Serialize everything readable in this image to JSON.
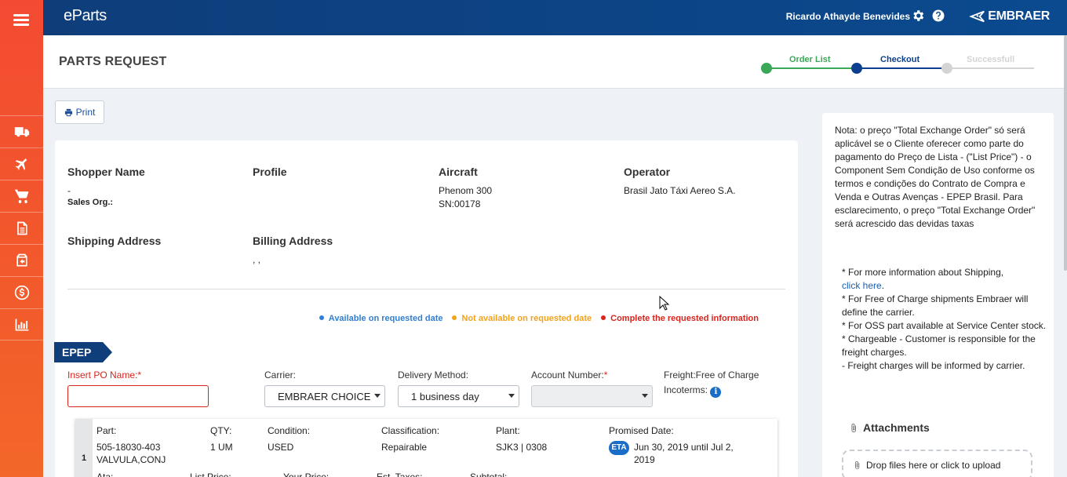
{
  "app": {
    "brand": "eParts",
    "user": "Ricardo Athayde Benevides",
    "logo_text": "EMBRAER"
  },
  "header": {
    "title": "PARTS REQUEST"
  },
  "stepper": {
    "steps": [
      {
        "label": "Order List",
        "state": "done"
      },
      {
        "label": "Checkout",
        "state": "current"
      },
      {
        "label": "Successfull",
        "state": "pending"
      }
    ],
    "colors": {
      "done": "#3aa856",
      "current": "#0d3f8f",
      "pending": "#d4d4d4"
    }
  },
  "sidebar": {
    "items": [
      {
        "icon": "truck-icon"
      },
      {
        "icon": "airplane-icon"
      },
      {
        "icon": "cart-icon"
      },
      {
        "icon": "document-icon"
      },
      {
        "icon": "package-return-icon"
      },
      {
        "icon": "dollar-icon"
      },
      {
        "icon": "bar-chart-icon"
      }
    ]
  },
  "toolbar": {
    "print_label": "Print"
  },
  "order": {
    "shopper_name_label": "Shopper Name",
    "shopper_name_value": "-",
    "sales_org_label": "Sales Org.:",
    "profile_label": "Profile",
    "aircraft_label": "Aircraft",
    "aircraft_model": "Phenom 300",
    "aircraft_sn": "SN:00178",
    "operator_label": "Operator",
    "operator_value": "Brasil Jato Táxi Aereo S.A.",
    "shipping_label": "Shipping Address",
    "billing_label": "Billing Address",
    "billing_value": ", ,"
  },
  "legend": [
    {
      "label": "Available on requested date",
      "color": "#2f7fd6"
    },
    {
      "label": "Not available on requested date",
      "color": "#f2a21b"
    },
    {
      "label": "Complete the requested information",
      "color": "#d9241c"
    }
  ],
  "section": {
    "tag": "EPEP"
  },
  "form": {
    "po_label": "Insert PO Name:",
    "required_mark": "*",
    "carrier_label": "Carrier:",
    "carrier_value": "EMBRAER CHOICE",
    "delivery_label": "Delivery Method:",
    "delivery_value": "1 business day",
    "account_label": "Account Number:",
    "freight_text": "Freight:Free of Charge",
    "incoterms_label": "Incoterms:",
    "info_glyph": "i"
  },
  "item": {
    "index": "1",
    "part_label": "Part:",
    "part_number": "505-18030-403",
    "part_name": "VALVULA,CONJ",
    "qty_label": "QTY:",
    "qty_value": "1 UM",
    "condition_label": "Condition:",
    "condition_value": "USED",
    "classification_label": "Classification:",
    "classification_value": "Repairable",
    "plant_label": "Plant:",
    "plant_value": "SJK3 | 0308",
    "promised_label": "Promised Date:",
    "eta_badge": "ETA",
    "promised_value": "Jun 30, 2019 until Jul 2, 2019",
    "row2_labels": [
      "Ata:",
      "List Price:",
      "Your Price:",
      "Est. Taxes:",
      "Subtotal:"
    ]
  },
  "right_panel": {
    "note": "Nota: o preço \"Total Exchange Order\" só será aplicável se o Cliente oferecer como parte do pagamento do Preço de Lista - (\"List Price\") - o Component Sem Condição de Uso conforme os termos e condições do Contrato de Compra e Venda e Outras Avenças - EPEP Brasil. Para esclarecimento, o preço \"Total Exchange Order\" será acrescido das devidas taxas",
    "shipping_intro": "* For more information about Shipping,",
    "shipping_link": "click here",
    "shipping_lines": [
      "* For Free of Charge shipments Embraer will define the carrier.",
      "* For OSS part available at Service Center stock.",
      "* Chargeable - Customer is responsible for the freight charges.",
      "- Freight charges will be informed by carrier."
    ],
    "attachments_title": "Attachments",
    "drop_text": "Drop files here or click to upload"
  }
}
